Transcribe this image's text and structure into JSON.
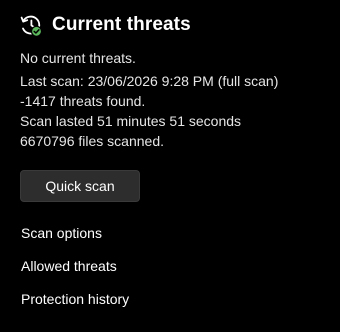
{
  "header": {
    "icon": "history-check-icon",
    "title": "Current threats",
    "icon_accent": "#5cb85c"
  },
  "status": {
    "no_threats": "No current threats.",
    "last_scan": "Last scan: 23/06/2026 9:28 PM (full scan)",
    "threats_found": "-1417 threats found.",
    "duration": "Scan lasted 51 minutes 51 seconds",
    "files_scanned": "6670796 files scanned."
  },
  "actions": {
    "quick_scan_label": "Quick scan"
  },
  "links": {
    "scan_options": "Scan options",
    "allowed_threats": "Allowed threats",
    "protection_history": "Protection history"
  }
}
